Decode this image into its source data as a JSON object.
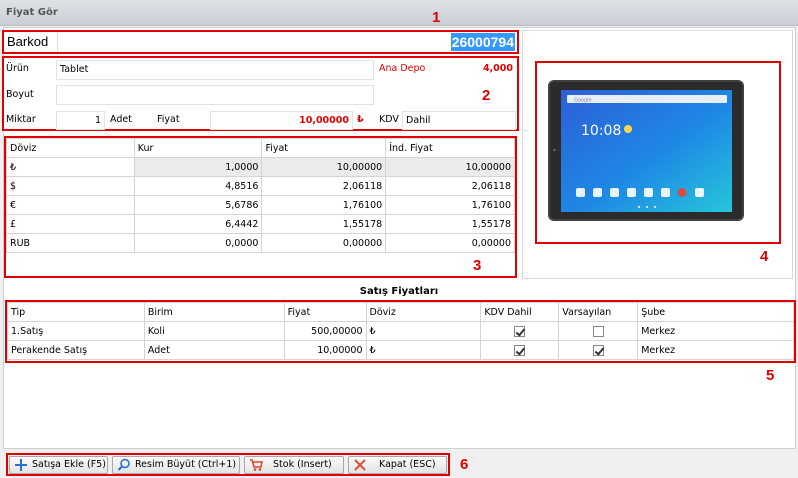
{
  "window": {
    "title": "Fiyat Gör"
  },
  "annotations": [
    "1",
    "2",
    "3",
    "4",
    "5",
    "6"
  ],
  "barcode": {
    "label": "Barkod",
    "value": "26000794"
  },
  "product": {
    "urun_label": "Ürün",
    "urun_value": "Tablet",
    "depo_label": "Ana Depo",
    "depo_value": "4,000",
    "boyut_label": "Boyut",
    "boyut_value": "",
    "miktar_label": "Miktar",
    "miktar_value": "1",
    "unit": "Adet",
    "fiyat_label": "Fiyat",
    "fiyat_value": "10,00000",
    "currency_symbol": "₺",
    "kdv_label": "KDV",
    "kdv_value": "Dahil"
  },
  "currency_table": {
    "headers": [
      "Döviz",
      "Kur",
      "Fiyat",
      "İnd. Fiyat"
    ],
    "rows": [
      [
        "₺",
        "1,0000",
        "10,00000",
        "10,00000"
      ],
      [
        "$",
        "4,8516",
        "2,06118",
        "2,06118"
      ],
      [
        "€",
        "5,6786",
        "1,76100",
        "1,76100"
      ],
      [
        "£",
        "6,4442",
        "1,55178",
        "1,55178"
      ],
      [
        "RUB",
        "0,0000",
        "0,00000",
        "0,00000"
      ]
    ]
  },
  "tablet_screen": {
    "search_text": "Google",
    "time": "10:08"
  },
  "sales": {
    "title": "Satış Fiyatları",
    "headers": [
      "Tip",
      "Birim",
      "Fiyat",
      "Döviz",
      "KDV Dahil",
      "Varsayılan",
      "Şube"
    ],
    "rows": [
      {
        "tip": "1.Satış",
        "birim": "Koli",
        "fiyat": "500,00000",
        "doviz": "₺",
        "kdv_dahil": true,
        "varsayilan": false,
        "sube": "Merkez"
      },
      {
        "tip": "Perakende Satış",
        "birim": "Adet",
        "fiyat": "10,00000",
        "doviz": "₺",
        "kdv_dahil": true,
        "varsayilan": true,
        "sube": "Merkez"
      }
    ]
  },
  "buttons": {
    "add_to_sale": "Satışa Ekle (F5)",
    "zoom_image": "Resim Büyüt (Ctrl+1)",
    "stock": "Stok (Insert)",
    "close": "Kapat (ESC)"
  },
  "icons": {
    "add": "plus-icon",
    "zoom": "magnifier-icon",
    "stock": "cart-icon",
    "close": "x-icon"
  },
  "colors": {
    "annotation": "#e00000",
    "barcode_highlight": "#3399ff",
    "price_red": "#e00000"
  }
}
